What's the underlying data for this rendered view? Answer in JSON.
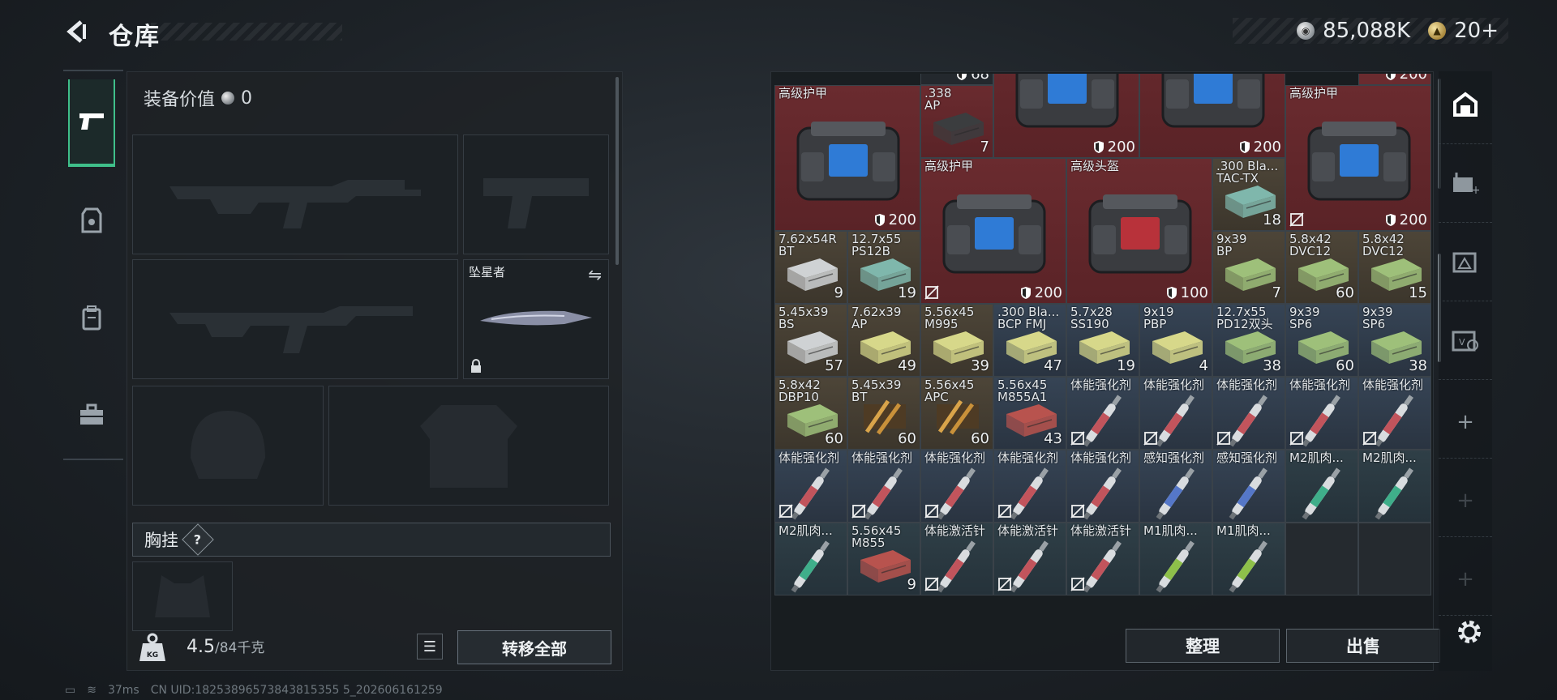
{
  "header": {
    "title": "仓库",
    "currency": [
      {
        "icon": "silver-coin-icon",
        "value": "85,088K"
      },
      {
        "icon": "gold-coin-icon",
        "value": "20+"
      }
    ]
  },
  "side_nav": [
    {
      "icon": "pistol-icon",
      "active": true
    },
    {
      "icon": "armor-vest-icon",
      "active": false
    },
    {
      "icon": "backpack-icon",
      "active": false
    },
    {
      "icon": "toolbox-icon",
      "active": false
    }
  ],
  "loadout": {
    "equip_value_label": "装备价值",
    "equip_value": "0",
    "melee_slot_label": "坠星者",
    "chest_rig_label": "胸挂",
    "chest_rig_help": "?",
    "weight_value": "4.5",
    "weight_max": "/84千克",
    "transfer_all_label": "转移全部"
  },
  "status_bar": {
    "ping": "37ms",
    "uid": "CN UID:18253896573843815355 5_202606161259"
  },
  "inventory": {
    "sort_label": "整理",
    "sell_label": "出售",
    "top_peek": [
      {
        "col": 2,
        "text": "68"
      },
      {
        "col": 8,
        "text": "200"
      }
    ],
    "items": [
      {
        "r": 0,
        "c": 0,
        "w": 2,
        "h": 2,
        "color": "red",
        "name": "高级护甲",
        "dur": "200",
        "art": "vest"
      },
      {
        "r": 0,
        "c": 2,
        "w": 1,
        "h": 1,
        "color": "red",
        "name": ".338\nAP",
        "count": "7",
        "art": "ammobox-dark"
      },
      {
        "r": -1,
        "c": 3,
        "w": 2,
        "h": 2,
        "color": "red",
        "name": "",
        "dur": "200",
        "art": "vest"
      },
      {
        "r": -1,
        "c": 5,
        "w": 2,
        "h": 2,
        "color": "red",
        "name": "",
        "dur": "200",
        "art": "vest"
      },
      {
        "r": 0,
        "c": 7,
        "w": 2,
        "h": 2,
        "color": "red",
        "name": "高级护甲",
        "dur": "200",
        "nodrop": true,
        "art": "vest"
      },
      {
        "r": 1,
        "c": 2,
        "w": 2,
        "h": 2,
        "color": "red",
        "name": "高级护甲",
        "dur": "200",
        "nodrop": true,
        "art": "vest"
      },
      {
        "r": 1,
        "c": 4,
        "w": 2,
        "h": 2,
        "color": "red",
        "name": "高级头盔",
        "dur": "100",
        "art": "vest-red"
      },
      {
        "r": 1,
        "c": 6,
        "w": 1,
        "h": 1,
        "color": "amber",
        "name": ".300 Bla...\nTAC-TX",
        "count": "18",
        "art": "ammo-teal"
      },
      {
        "r": 2,
        "c": 0,
        "w": 1,
        "h": 1,
        "color": "amber",
        "name": "7.62x54R\nBT",
        "count": "9",
        "art": "ammo-white"
      },
      {
        "r": 2,
        "c": 1,
        "w": 1,
        "h": 1,
        "color": "amber",
        "name": "12.7x55\nPS12B",
        "count": "19",
        "art": "ammo-teal"
      },
      {
        "r": 2,
        "c": 6,
        "w": 1,
        "h": 1,
        "color": "amber",
        "name": "9x39\nBP",
        "count": "7",
        "art": "ammo-green"
      },
      {
        "r": 2,
        "c": 7,
        "w": 1,
        "h": 1,
        "color": "amber",
        "name": "5.8x42\nDVC12",
        "count": "60",
        "art": "ammo-green"
      },
      {
        "r": 2,
        "c": 8,
        "w": 1,
        "h": 1,
        "color": "amber",
        "name": "5.8x42\nDVC12",
        "count": "15",
        "art": "ammo-green"
      },
      {
        "r": 3,
        "c": 0,
        "w": 1,
        "h": 1,
        "color": "amber",
        "name": "5.45x39\nBS",
        "count": "57",
        "art": "ammo-white"
      },
      {
        "r": 3,
        "c": 1,
        "w": 1,
        "h": 1,
        "color": "amber",
        "name": "7.62x39\nAP",
        "count": "49",
        "art": "ammo-yellow"
      },
      {
        "r": 3,
        "c": 2,
        "w": 1,
        "h": 1,
        "color": "amber",
        "name": "5.56x45\nM995",
        "count": "39",
        "art": "ammo-yellow"
      },
      {
        "r": 3,
        "c": 3,
        "w": 1,
        "h": 1,
        "color": "blue",
        "name": ".300 Bla...\nBCP FMJ",
        "count": "47",
        "art": "ammo-yellow"
      },
      {
        "r": 3,
        "c": 4,
        "w": 1,
        "h": 1,
        "color": "blue",
        "name": "5.7x28\nSS190",
        "count": "19",
        "art": "ammo-yellow"
      },
      {
        "r": 3,
        "c": 5,
        "w": 1,
        "h": 1,
        "color": "blue",
        "name": "9x19\nPBP",
        "count": "4",
        "art": "ammo-yellow"
      },
      {
        "r": 3,
        "c": 6,
        "w": 1,
        "h": 1,
        "color": "blue",
        "name": "12.7x55\nPD12双头",
        "count": "38",
        "art": "ammo-green"
      },
      {
        "r": 3,
        "c": 7,
        "w": 1,
        "h": 1,
        "color": "blue",
        "name": "9x39\nSP6",
        "count": "60",
        "art": "ammo-green"
      },
      {
        "r": 3,
        "c": 8,
        "w": 1,
        "h": 1,
        "color": "blue",
        "name": "9x39\nSP6",
        "count": "38",
        "art": "ammo-green"
      },
      {
        "r": 4,
        "c": 0,
        "w": 1,
        "h": 1,
        "color": "amber",
        "name": "5.8x42\nDBP10",
        "count": "60",
        "art": "ammo-green"
      },
      {
        "r": 4,
        "c": 1,
        "w": 1,
        "h": 1,
        "color": "amber",
        "name": "5.45x39\nBT",
        "count": "60",
        "art": "ammo-brass"
      },
      {
        "r": 4,
        "c": 2,
        "w": 1,
        "h": 1,
        "color": "amber",
        "name": "5.56x45\nAPC",
        "count": "60",
        "art": "ammo-brass"
      },
      {
        "r": 4,
        "c": 3,
        "w": 1,
        "h": 1,
        "color": "blue",
        "name": "5.56x45\nM855A1",
        "count": "43",
        "art": "ammo-red"
      },
      {
        "r": 4,
        "c": 4,
        "w": 1,
        "h": 1,
        "color": "blue",
        "name": "体能强化剂",
        "nodrop": true,
        "art": "injector-red"
      },
      {
        "r": 4,
        "c": 5,
        "w": 1,
        "h": 1,
        "color": "blue",
        "name": "体能强化剂",
        "nodrop": true,
        "art": "injector-red"
      },
      {
        "r": 4,
        "c": 6,
        "w": 1,
        "h": 1,
        "color": "blue",
        "name": "体能强化剂",
        "nodrop": true,
        "art": "injector-red"
      },
      {
        "r": 4,
        "c": 7,
        "w": 1,
        "h": 1,
        "color": "blue",
        "name": "体能强化剂",
        "nodrop": true,
        "art": "injector-red"
      },
      {
        "r": 4,
        "c": 8,
        "w": 1,
        "h": 1,
        "color": "blue",
        "name": "体能强化剂",
        "nodrop": true,
        "art": "injector-red"
      },
      {
        "r": 5,
        "c": 0,
        "w": 1,
        "h": 1,
        "color": "blue",
        "name": "体能强化剂",
        "nodrop": true,
        "art": "injector-red"
      },
      {
        "r": 5,
        "c": 1,
        "w": 1,
        "h": 1,
        "color": "blue",
        "name": "体能强化剂",
        "nodrop": true,
        "art": "injector-red"
      },
      {
        "r": 5,
        "c": 2,
        "w": 1,
        "h": 1,
        "color": "blue",
        "name": "体能强化剂",
        "nodrop": true,
        "art": "injector-red"
      },
      {
        "r": 5,
        "c": 3,
        "w": 1,
        "h": 1,
        "color": "blue",
        "name": "体能强化剂",
        "nodrop": true,
        "art": "injector-red"
      },
      {
        "r": 5,
        "c": 4,
        "w": 1,
        "h": 1,
        "color": "blue",
        "name": "体能强化剂",
        "nodrop": true,
        "art": "injector-red"
      },
      {
        "r": 5,
        "c": 5,
        "w": 1,
        "h": 1,
        "color": "blue",
        "name": "感知强化剂",
        "art": "injector-blue"
      },
      {
        "r": 5,
        "c": 6,
        "w": 1,
        "h": 1,
        "color": "blue",
        "name": "感知强化剂",
        "art": "injector-blue"
      },
      {
        "r": 5,
        "c": 7,
        "w": 1,
        "h": 1,
        "color": "teal",
        "name": "M2肌肉...",
        "art": "injector-green"
      },
      {
        "r": 5,
        "c": 8,
        "w": 1,
        "h": 1,
        "color": "teal",
        "name": "M2肌肉...",
        "art": "injector-green"
      },
      {
        "r": 6,
        "c": 0,
        "w": 1,
        "h": 1,
        "color": "teal",
        "name": "M2肌肉...",
        "art": "injector-green"
      },
      {
        "r": 6,
        "c": 1,
        "w": 1,
        "h": 1,
        "color": "teal",
        "name": "5.56x45\nM855",
        "count": "9",
        "art": "ammo-red"
      },
      {
        "r": 6,
        "c": 2,
        "w": 1,
        "h": 1,
        "color": "teal",
        "name": "体能激活针",
        "nodrop": true,
        "art": "injector-red"
      },
      {
        "r": 6,
        "c": 3,
        "w": 1,
        "h": 1,
        "color": "teal",
        "name": "体能激活针",
        "nodrop": true,
        "art": "injector-red"
      },
      {
        "r": 6,
        "c": 4,
        "w": 1,
        "h": 1,
        "color": "teal",
        "name": "体能激活针",
        "nodrop": true,
        "art": "injector-red"
      },
      {
        "r": 6,
        "c": 5,
        "w": 1,
        "h": 1,
        "color": "teal",
        "name": "M1肌肉...",
        "art": "injector-lime"
      },
      {
        "r": 6,
        "c": 6,
        "w": 1,
        "h": 1,
        "color": "teal",
        "name": "M1肌肉...",
        "art": "injector-lime"
      },
      {
        "r": 6,
        "c": 7,
        "w": 1,
        "h": 1,
        "color": "dark",
        "name": "",
        "art": ""
      },
      {
        "r": 6,
        "c": 8,
        "w": 1,
        "h": 1,
        "color": "dark",
        "name": "",
        "art": ""
      }
    ]
  },
  "right_rail": [
    {
      "icon": "stash-icon",
      "active": true
    },
    {
      "icon": "case-add-icon",
      "active": false
    },
    {
      "icon": "gear-case-icon",
      "active": false
    },
    {
      "icon": "value-case-icon",
      "active": false
    },
    {
      "icon": "add-icon",
      "active": false,
      "glyph": "+"
    },
    {
      "icon": "add-icon",
      "active": false,
      "glyph": "+"
    },
    {
      "icon": "add-icon",
      "active": false,
      "glyph": "+"
    }
  ],
  "colors": {
    "accent": "#3fbf8a",
    "red_cell": "#6a2b2f",
    "amber_cell": "#4d4538",
    "blue_cell": "#364455",
    "teal_cell": "#2f3f47"
  }
}
